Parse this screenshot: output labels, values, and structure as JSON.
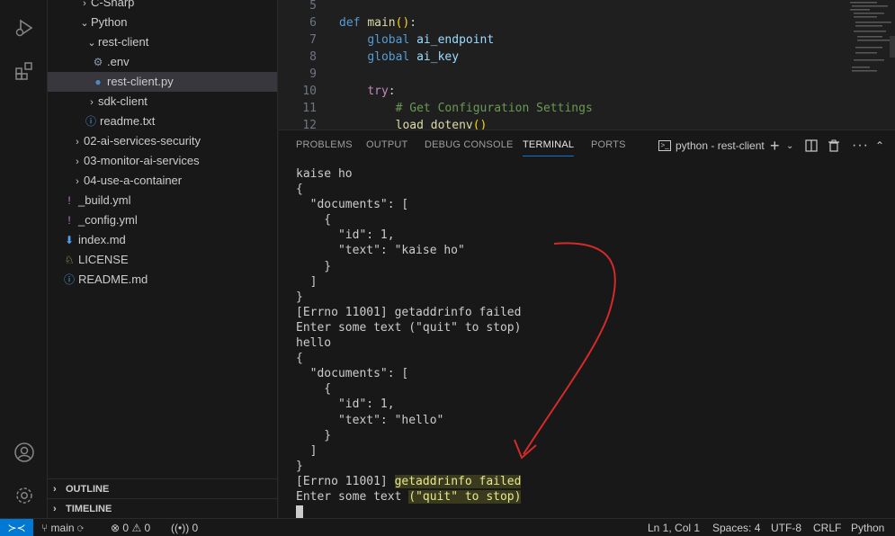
{
  "explorer": {
    "items": [
      {
        "label": "C-Sharp",
        "chev": "›",
        "icon": "",
        "indent": 34,
        "kind": "folder"
      },
      {
        "label": "Python",
        "chev": "⌄",
        "icon": "",
        "indent": 34,
        "kind": "folder"
      },
      {
        "label": "rest-client",
        "chev": "⌄",
        "icon": "",
        "indent": 42,
        "kind": "folder"
      },
      {
        "label": ".env",
        "chev": "",
        "icon": "gear-icon",
        "indent": 48,
        "kind": "file"
      },
      {
        "label": "rest-client.py",
        "chev": "",
        "icon": "python-icon",
        "indent": 48,
        "kind": "file",
        "selected": true
      },
      {
        "label": "sdk-client",
        "chev": "›",
        "icon": "",
        "indent": 42,
        "kind": "folder"
      },
      {
        "label": "readme.txt",
        "chev": "",
        "icon": "info-icon",
        "indent": 40,
        "kind": "file"
      },
      {
        "label": "02-ai-services-security",
        "chev": "›",
        "icon": "",
        "indent": 26,
        "kind": "folder"
      },
      {
        "label": "03-monitor-ai-services",
        "chev": "›",
        "icon": "",
        "indent": 26,
        "kind": "folder"
      },
      {
        "label": "04-use-a-container",
        "chev": "›",
        "icon": "",
        "indent": 26,
        "kind": "folder"
      },
      {
        "label": "_build.yml",
        "chev": "",
        "icon": "exclamation-icon",
        "indent": 16,
        "kind": "file"
      },
      {
        "label": "_config.yml",
        "chev": "",
        "icon": "exclamation-icon",
        "indent": 16,
        "kind": "file"
      },
      {
        "label": "index.md",
        "chev": "",
        "icon": "markdown-icon",
        "indent": 16,
        "kind": "file"
      },
      {
        "label": "LICENSE",
        "chev": "",
        "icon": "license-icon",
        "indent": 16,
        "kind": "file"
      },
      {
        "label": "README.md",
        "chev": "",
        "icon": "info-icon",
        "indent": 16,
        "kind": "file"
      }
    ],
    "outline_label": "OUTLINE",
    "timeline_label": "TIMELINE"
  },
  "editor": {
    "lines": [
      {
        "num": "5",
        "tokens": []
      },
      {
        "num": "6",
        "tokens": [
          [
            "kw",
            "def "
          ],
          [
            "fn",
            "main"
          ],
          [
            "br",
            "()"
          ],
          [
            "",
            ":"
          ]
        ]
      },
      {
        "num": "7",
        "tokens": [
          [
            "",
            "    "
          ],
          [
            "kw",
            "global "
          ],
          [
            "var",
            "ai_endpoint"
          ]
        ]
      },
      {
        "num": "8",
        "tokens": [
          [
            "",
            "    "
          ],
          [
            "kw",
            "global "
          ],
          [
            "var",
            "ai_key"
          ]
        ]
      },
      {
        "num": "9",
        "tokens": []
      },
      {
        "num": "10",
        "tokens": [
          [
            "",
            "    "
          ],
          [
            "kw2",
            "try"
          ],
          [
            "",
            ":"
          ]
        ]
      },
      {
        "num": "11",
        "tokens": [
          [
            "",
            "        "
          ],
          [
            "cm",
            "# Get Configuration Settings"
          ]
        ]
      },
      {
        "num": "12",
        "tokens": [
          [
            "",
            "        "
          ],
          [
            "fn",
            "load_dotenv"
          ],
          [
            "br",
            "()"
          ]
        ]
      }
    ]
  },
  "panel": {
    "tabs": [
      {
        "label": "PROBLEMS",
        "active": false
      },
      {
        "label": "OUTPUT",
        "active": false
      },
      {
        "label": "DEBUG CONSOLE",
        "active": false
      },
      {
        "label": "TERMINAL",
        "active": true
      },
      {
        "label": "PORTS",
        "active": false
      }
    ],
    "terminal_name": "python - rest-client"
  },
  "terminal": {
    "lines": [
      "kaise ho",
      "{",
      "  \"documents\": [",
      "    {",
      "      \"id\": 1,",
      "      \"text\": \"kaise ho\"",
      "    }",
      "  ]",
      "}",
      "[Errno 11001] getaddrinfo failed",
      "Enter some text (\"quit\" to stop)",
      "hello",
      "{",
      "  \"documents\": [",
      "    {",
      "      \"id\": 1,",
      "      \"text\": \"hello\"",
      "    }",
      "  ]",
      "}",
      "[Errno 11001] getaddrinfo failed",
      "Enter some text (\"quit\" to stop)"
    ],
    "annotation_color": "#d42a2a"
  },
  "statusbar": {
    "branch": "main",
    "errors": "0",
    "warnings": "0",
    "ports": "0",
    "position": "Ln 1, Col 1",
    "spaces": "Spaces: 4",
    "encoding": "UTF-8",
    "eol": "CRLF",
    "language": "Python"
  },
  "colors": {
    "accent": "#0078d4",
    "background": "#1e1e1e",
    "sidebar": "#181818"
  }
}
